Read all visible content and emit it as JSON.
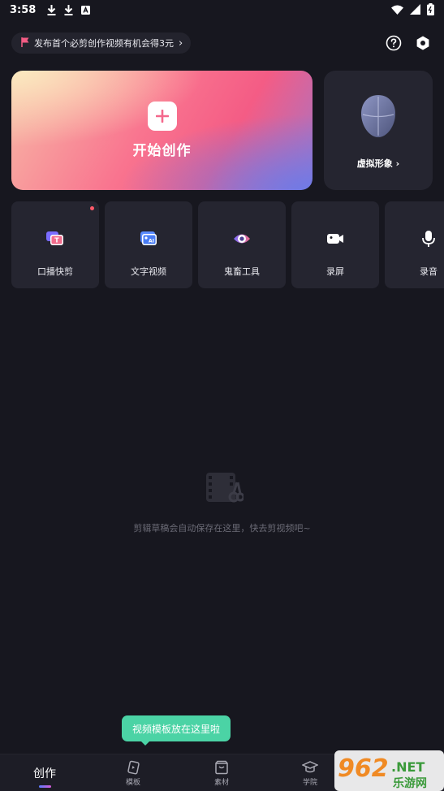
{
  "status_bar": {
    "time": "3:58"
  },
  "promo": {
    "text": "发布首个必剪创作视频有机会得3元",
    "chevron": "›"
  },
  "create": {
    "label": "开始创作"
  },
  "avatar": {
    "label": "虚拟形象",
    "chevron": "›"
  },
  "tools": [
    {
      "label": "口播快剪",
      "icon": "text-bubble-icon",
      "badge": true
    },
    {
      "label": "文字视频",
      "icon": "ai-card-icon",
      "badge": false
    },
    {
      "label": "鬼畜工具",
      "icon": "ghost-eye-icon",
      "badge": false
    },
    {
      "label": "录屏",
      "icon": "camera-icon",
      "badge": false
    },
    {
      "label": "录音",
      "icon": "microphone-icon",
      "badge": false
    }
  ],
  "empty": {
    "text": "剪辑草稿会自动保存在这里，快去剪视频吧~"
  },
  "tooltip": {
    "text": "视频模板放在这里啦"
  },
  "nav": [
    {
      "label": "创作",
      "active": true
    },
    {
      "label": "模板",
      "active": false
    },
    {
      "label": "素材",
      "active": false
    },
    {
      "label": "学院",
      "active": false
    }
  ],
  "watermark": {
    "text": "962",
    "suffix": ".NET",
    "sub": "乐游网"
  },
  "colors": {
    "background": "#17171f",
    "card": "#252530",
    "tooltip": "#4bd3a5",
    "accent_pink": "#f45c85",
    "red_dot": "#ff5a6a"
  }
}
